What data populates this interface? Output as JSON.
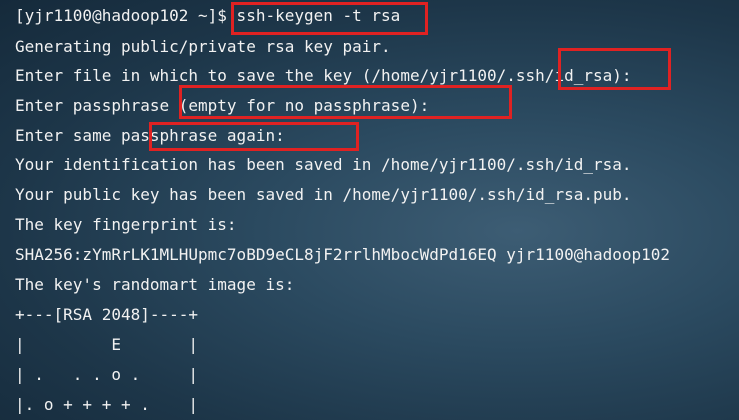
{
  "terminal": {
    "lines": [
      "[yjr1100@hadoop102 ~]$ ssh-keygen -t rsa",
      "Generating public/private rsa key pair.",
      "Enter file in which to save the key (/home/yjr1100/.ssh/id_rsa):",
      "Enter passphrase (empty for no passphrase):",
      "Enter same passphrase again:",
      "Your identification has been saved in /home/yjr1100/.ssh/id_rsa.",
      "Your public key has been saved in /home/yjr1100/.ssh/id_rsa.pub.",
      "The key fingerprint is:",
      "SHA256:zYmRrLK1MLHUpmc7oBD9eCL8jF2rrlhMbocWdPd16EQ yjr1100@hadoop102",
      "The key's randomart image is:",
      "+---[RSA 2048]----+",
      "|         E       |",
      "| .   . . o .     |",
      "|. o + + + + .    |"
    ]
  },
  "colors": {
    "highlight": "#e02222",
    "text": "#f2f2f2"
  }
}
